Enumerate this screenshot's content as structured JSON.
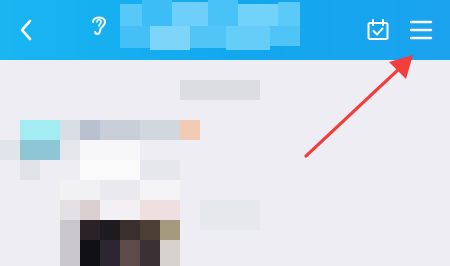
{
  "header": {
    "background": "#14aaf0",
    "icons": {
      "back": "chevron-left-icon",
      "listen": "ear-icon",
      "calendar": "calendar-check-icon",
      "menu": "hamburger-menu-icon"
    }
  },
  "annotation": {
    "type": "red-arrow",
    "color": "#f23d3d",
    "points_to": "menu-button"
  },
  "content": {
    "title_redacted": true,
    "profile_redacted": true
  }
}
